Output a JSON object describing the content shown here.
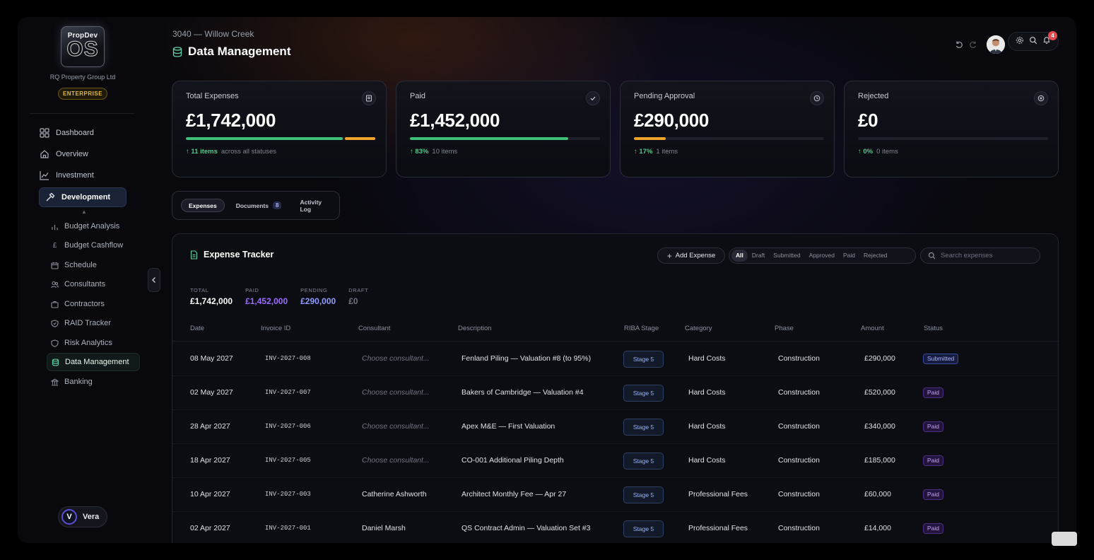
{
  "brand": {
    "logo_top": "PropDev",
    "logo_os": "OS",
    "company": "RQ Property Group Ltd",
    "plan": "ENTERPRISE"
  },
  "nav": {
    "main": [
      {
        "label": "Dashboard",
        "icon": "grid-icon"
      },
      {
        "label": "Overview",
        "icon": "home-icon"
      },
      {
        "label": "Investment",
        "icon": "trend-icon"
      },
      {
        "label": "Development",
        "icon": "hammer-icon",
        "active": true
      }
    ],
    "sub": [
      {
        "label": "Budget Analysis",
        "icon": "bar-chart-icon"
      },
      {
        "label": "Budget Cashflow",
        "icon": "pound-icon"
      },
      {
        "label": "Schedule",
        "icon": "calendar-icon"
      },
      {
        "label": "Consultants",
        "icon": "users-icon"
      },
      {
        "label": "Contractors",
        "icon": "briefcase-icon"
      },
      {
        "label": "RAID Tracker",
        "icon": "shield-icon"
      },
      {
        "label": "Risk Analytics",
        "icon": "shield-outline-icon"
      },
      {
        "label": "Data Management",
        "icon": "database-icon",
        "active": true
      },
      {
        "label": "Banking",
        "icon": "bank-icon"
      }
    ]
  },
  "user": {
    "initial": "V",
    "name": "Vera"
  },
  "header": {
    "project": "3040 — Willow Creek",
    "title": "Data Management",
    "notifications": "4"
  },
  "stats": [
    {
      "label": "Total Expenses",
      "value": "£1,742,000",
      "change": "11 items",
      "note": "across all statuses",
      "icon": "receipt-icon"
    },
    {
      "label": "Paid",
      "value": "£1,452,000",
      "change": "83%",
      "note": "10 items",
      "icon": "check-icon"
    },
    {
      "label": "Pending Approval",
      "value": "£290,000",
      "change": "17%",
      "note": "1 items",
      "icon": "clock-icon"
    },
    {
      "label": "Rejected",
      "value": "£0",
      "change": "0%",
      "note": "0 items",
      "icon": "x-circle-icon"
    }
  ],
  "stat_bars": {
    "total": {
      "paid_fraction": 0.833,
      "pending_fraction": 0.167
    },
    "paid": {
      "fraction": 0.833
    },
    "pending": {
      "fraction": 0.167
    },
    "rejected": {
      "fraction": 0
    }
  },
  "colors": {
    "green": "#3fbf7a",
    "amber": "#f0a32a",
    "purple": "#9b6cff",
    "blue": "#8f9bff",
    "accent": "#2a3550"
  },
  "tabs": [
    {
      "label": "Expenses",
      "active": true
    },
    {
      "label": "Documents",
      "count": "8"
    },
    {
      "label": "Activity Log"
    }
  ],
  "tracker": {
    "title": "Expense Tracker",
    "add_label": "Add Expense",
    "filters": [
      "All",
      "Draft",
      "Submitted",
      "Approved",
      "Paid",
      "Rejected"
    ],
    "search_placeholder": "Search expenses",
    "summary": [
      {
        "label": "TOTAL",
        "value": "£1,742,000"
      },
      {
        "label": "PAID",
        "value": "£1,452,000"
      },
      {
        "label": "PENDING",
        "value": "£290,000"
      },
      {
        "label": "DRAFT",
        "value": "£0"
      }
    ],
    "columns": [
      "Date",
      "Invoice ID",
      "Consultant",
      "Description",
      "RIBA Stage",
      "Category",
      "Phase",
      "Amount",
      "Status"
    ],
    "rows": [
      {
        "date": "08 May 2027",
        "invoice": "INV-2027-008",
        "consultant": "Choose consultant...",
        "placeholder": true,
        "description": "Fenland Piling — Valuation #8 (to 95%)",
        "stage": "Stage 5",
        "category": "Hard Costs",
        "phase": "Construction",
        "amount": "£290,000",
        "status": "Submitted"
      },
      {
        "date": "02 May 2027",
        "invoice": "INV-2027-007",
        "consultant": "Choose consultant...",
        "placeholder": true,
        "description": "Bakers of Cambridge — Valuation #4",
        "stage": "Stage 5",
        "category": "Hard Costs",
        "phase": "Construction",
        "amount": "£520,000",
        "status": "Paid"
      },
      {
        "date": "28 Apr 2027",
        "invoice": "INV-2027-006",
        "consultant": "Choose consultant...",
        "placeholder": true,
        "description": "Apex M&E — First Valuation",
        "stage": "Stage 5",
        "category": "Hard Costs",
        "phase": "Construction",
        "amount": "£340,000",
        "status": "Paid"
      },
      {
        "date": "18 Apr 2027",
        "invoice": "INV-2027-005",
        "consultant": "Choose consultant...",
        "placeholder": true,
        "description": "CO-001 Additional Piling Depth",
        "stage": "Stage 5",
        "category": "Hard Costs",
        "phase": "Construction",
        "amount": "£185,000",
        "status": "Paid"
      },
      {
        "date": "10 Apr 2027",
        "invoice": "INV-2027-003",
        "consultant": "Catherine Ashworth",
        "placeholder": false,
        "description": "Architect Monthly Fee — Apr 27",
        "stage": "Stage 5",
        "category": "Professional Fees",
        "phase": "Construction",
        "amount": "£60,000",
        "status": "Paid"
      },
      {
        "date": "02 Apr 2027",
        "invoice": "INV-2027-001",
        "consultant": "Daniel Marsh",
        "placeholder": false,
        "description": "QS Contract Admin — Valuation Set #3",
        "stage": "Stage 5",
        "category": "Professional Fees",
        "phase": "Construction",
        "amount": "£14,000",
        "status": "Paid"
      }
    ]
  }
}
